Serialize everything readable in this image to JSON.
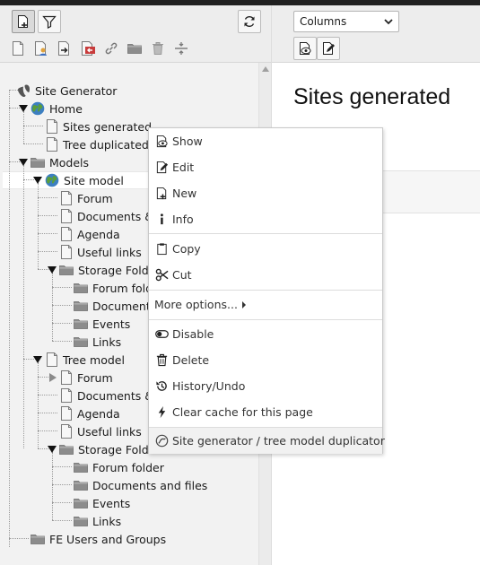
{
  "left_toolbar": {
    "buttons": [
      "new-page-icon",
      "filter-icon",
      "refresh-icon"
    ],
    "page_tools": [
      "page-icon",
      "page-user-icon",
      "page-move-icon",
      "page-delete-icon",
      "link-icon",
      "folder-icon",
      "trash-icon",
      "divider-icon"
    ]
  },
  "tree": {
    "root": "Site Generator",
    "home": "Home",
    "sites_generated": "Sites generated",
    "tree_duplicated": "Tree duplicated",
    "models": "Models",
    "site_model": "Site model",
    "sm_forum": "Forum",
    "sm_documents": "Documents &",
    "sm_agenda": "Agenda",
    "sm_useful": "Useful links",
    "sm_storage": "Storage Folde",
    "sm_forum_folder": "Forum folde",
    "sm_documents_files": "Document",
    "sm_events": "Events",
    "sm_links": "Links",
    "tree_model": "Tree model",
    "tm_forum": "Forum",
    "tm_documents": "Documents &",
    "tm_agenda": "Agenda",
    "tm_useful": "Useful links",
    "tm_storage": "Storage Folde",
    "tm_forum_folder": "Forum folder",
    "tm_documents_files": "Documents and files",
    "tm_events": "Events",
    "tm_links": "Links",
    "fe_users": "FE Users and Groups"
  },
  "right": {
    "view_select": "Columns",
    "page_title": "Sites generated"
  },
  "context_menu": {
    "show": "Show",
    "edit": "Edit",
    "new": "New",
    "info": "Info",
    "copy": "Copy",
    "cut": "Cut",
    "more": "More options...",
    "disable": "Disable",
    "delete": "Delete",
    "history": "History/Undo",
    "clear_cache": "Clear cache for this page",
    "generator": "Site generator / tree model duplicator"
  },
  "colors": {
    "page_icon_fill": "#f7f7f7",
    "folder_gray": "#8c8c8c",
    "globe_green": "#5a9e3b",
    "globe_blue": "#3c7fc1",
    "delete_red": "#c83c3c"
  }
}
